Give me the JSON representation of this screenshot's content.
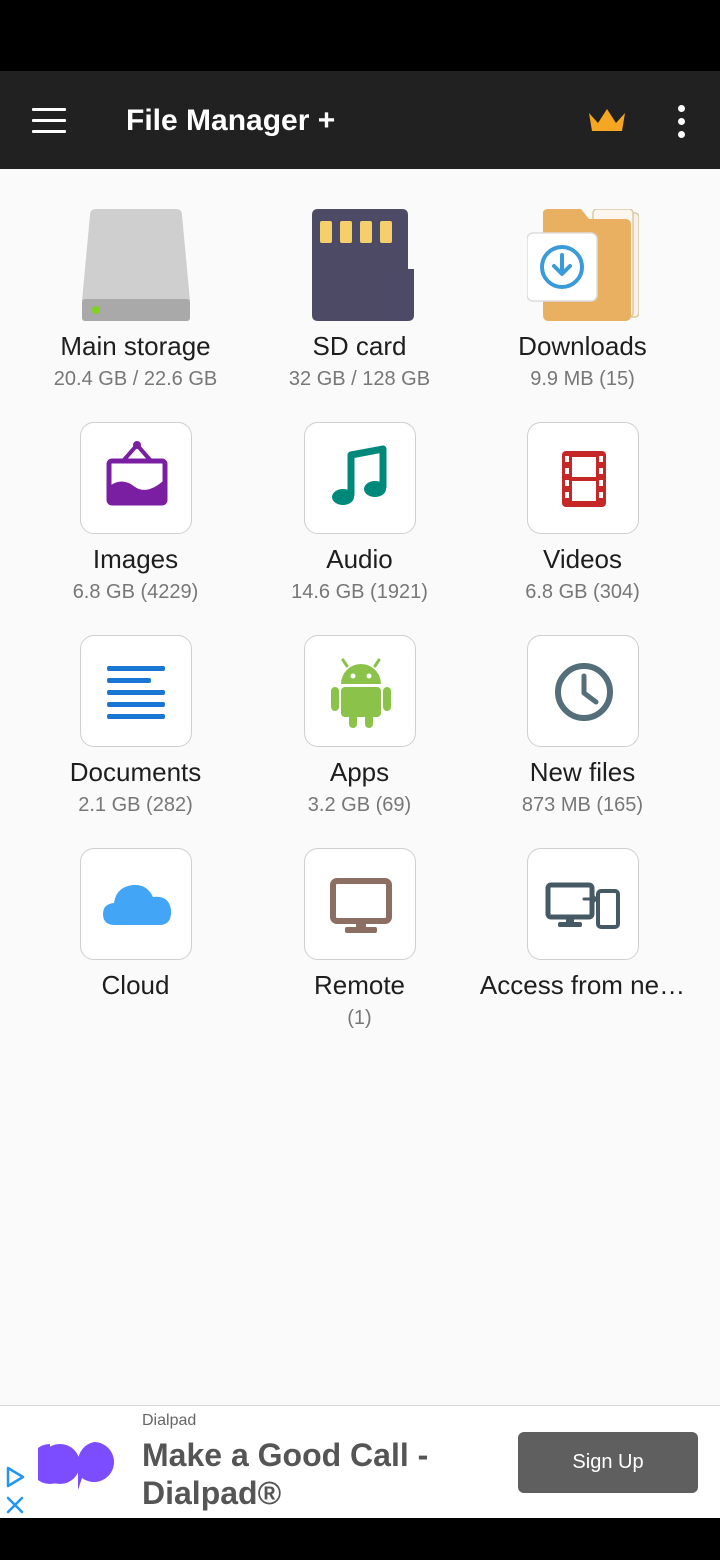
{
  "app_bar": {
    "title": "File Manager +"
  },
  "tiles": [
    {
      "label": "Main storage",
      "sub": "20.4 GB / 22.6 GB",
      "icon": "hard-drive-icon"
    },
    {
      "label": "SD card",
      "sub": "32 GB / 128 GB",
      "icon": "sd-card-icon"
    },
    {
      "label": "Downloads",
      "sub": "9.9 MB (15)",
      "icon": "downloads-folder-icon"
    },
    {
      "label": "Images",
      "sub": "6.8 GB (4229)",
      "icon": "image-icon"
    },
    {
      "label": "Audio",
      "sub": "14.6 GB (1921)",
      "icon": "music-note-icon"
    },
    {
      "label": "Videos",
      "sub": "6.8 GB (304)",
      "icon": "film-icon"
    },
    {
      "label": "Documents",
      "sub": "2.1 GB (282)",
      "icon": "document-icon"
    },
    {
      "label": "Apps",
      "sub": "3.2 GB (69)",
      "icon": "android-icon"
    },
    {
      "label": "New files",
      "sub": "873 MB (165)",
      "icon": "clock-icon"
    },
    {
      "label": "Cloud",
      "sub": "",
      "icon": "cloud-icon"
    },
    {
      "label": "Remote",
      "sub": "(1)",
      "icon": "monitor-icon"
    },
    {
      "label": "Access from ne…",
      "sub": "",
      "icon": "devices-icon"
    }
  ],
  "ad": {
    "brand": "Dialpad",
    "headline": "Make a Good Call - Dialpad®",
    "cta": "Sign Up"
  },
  "colors": {
    "app_bar": "#212121",
    "crown": "#f5a623",
    "image_purple": "#7b1fa2",
    "audio_teal": "#00897b",
    "video_red": "#c62828",
    "doc_blue": "#1976d2",
    "android_green": "#8bc34a",
    "clock_slate": "#546e7a",
    "cloud_blue": "#42a5f5",
    "remote_brown": "#8d6e63",
    "dialpad_purple": "#7c4dff"
  }
}
